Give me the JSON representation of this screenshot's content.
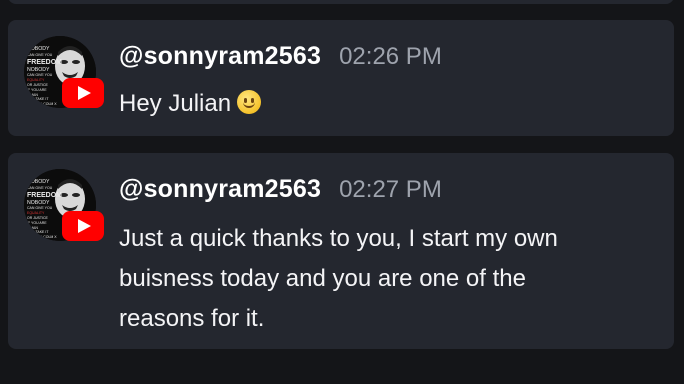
{
  "messages": [
    {
      "username": "@sonnyram2563",
      "time": "02:26 PM",
      "text": "Hey Julian",
      "emoji": "slightly-smiling-face",
      "avatar_text": [
        "NOBODY",
        "CAN GIVE YOU",
        "FREEDOM",
        "NOBODY",
        "CAN GIVE YOU",
        "EQUALITY",
        "OR JUSTICE",
        "IF YOU ARE",
        "A MAN",
        "YOU TAKE IT",
        "MALCOLM X"
      ]
    },
    {
      "username": "@sonnyram2563",
      "time": "02:27 PM",
      "text_lines": [
        "Just a quick thanks to you, I start my own",
        "buisness today and you are one of the",
        "reasons for it."
      ],
      "avatar_text": [
        "NOBODY",
        "CAN GIVE YOU",
        "FREEDOM",
        "NOBODY",
        "CAN GIVE YOU",
        "EQUALITY",
        "OR JUSTICE",
        "IF YOU ARE",
        "A MAN",
        "YOU TAKE IT",
        "MALCOLM X"
      ]
    }
  ],
  "colors": {
    "background": "#141518",
    "card": "#24272f",
    "username": "#ffffff",
    "timestamp": "#9ea3ad",
    "youtube_red": "#ff0000"
  },
  "icons": {
    "badge": "youtube-icon"
  }
}
